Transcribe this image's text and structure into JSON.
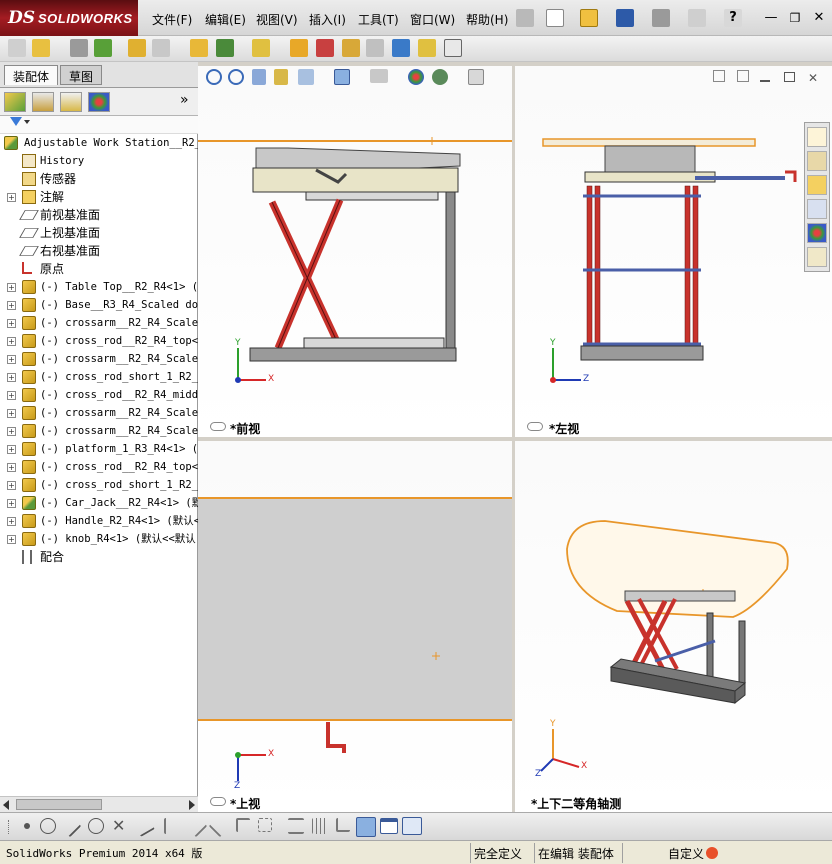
{
  "app": {
    "brand_ds": "DS",
    "brand_name": "SOLIDWORKS"
  },
  "menu": [
    "文件(F)",
    "编辑(E)",
    "视图(V)",
    "插入(I)",
    "工具(T)",
    "窗口(W)",
    "帮助(H)"
  ],
  "left_panel": {
    "tabs": [
      "装配体",
      "草图"
    ],
    "collapse_glyph": "»",
    "tree": [
      {
        "label": "Adjustable Work Station__R2_R4",
        "kind": "asm",
        "expand": ""
      },
      {
        "label": "History",
        "kind": "history",
        "expand": ""
      },
      {
        "label": "传感器",
        "kind": "sensor",
        "expand": ""
      },
      {
        "label": "注解",
        "kind": "annot",
        "expand": "+"
      },
      {
        "label": "前视基准面",
        "kind": "plane",
        "expand": ""
      },
      {
        "label": "上视基准面",
        "kind": "plane",
        "expand": ""
      },
      {
        "label": "右视基准面",
        "kind": "plane",
        "expand": ""
      },
      {
        "label": "原点",
        "kind": "origin",
        "expand": ""
      },
      {
        "label": "(-) Table Top__R2_R4<1> (默",
        "kind": "part",
        "expand": "+"
      },
      {
        "label": "(-) Base__R3_R4_Scaled dow",
        "kind": "part",
        "expand": "+"
      },
      {
        "label": "(-) crossarm__R2_R4_Scaled",
        "kind": "part",
        "expand": "+"
      },
      {
        "label": "(-) cross_rod__R2_R4_top<",
        "kind": "part",
        "expand": "+"
      },
      {
        "label": "(-) crossarm__R2_R4_Scaled",
        "kind": "part",
        "expand": "+"
      },
      {
        "label": "(-) cross_rod_short_1_R2_R",
        "kind": "part",
        "expand": "+"
      },
      {
        "label": "(-) cross_rod__R2_R4_middl",
        "kind": "part",
        "expand": "+"
      },
      {
        "label": "(-) crossarm__R2_R4_Scaled",
        "kind": "part",
        "expand": "+"
      },
      {
        "label": "(-) crossarm__R2_R4_Scaled",
        "kind": "part",
        "expand": "+"
      },
      {
        "label": "(-) platform_1_R3_R4<1> (默",
        "kind": "part",
        "expand": "+"
      },
      {
        "label": "(-) cross_rod__R2_R4_top<",
        "kind": "part",
        "expand": "+"
      },
      {
        "label": "(-) cross_rod_short_1_R2_R",
        "kind": "part",
        "expand": "+"
      },
      {
        "label": "(-) Car_Jack__R2_R4<1> (默",
        "kind": "asm",
        "expand": "+"
      },
      {
        "label": "(-) Handle_R2_R4<1> (默认<",
        "kind": "part",
        "expand": "+"
      },
      {
        "label": "(-) knob_R4<1> (默认<<默认",
        "kind": "part",
        "expand": "+"
      },
      {
        "label": "配合",
        "kind": "mate",
        "expand": ""
      }
    ]
  },
  "viewports": {
    "front": {
      "label": "*前视"
    },
    "left": {
      "label": "*左视"
    },
    "top": {
      "label": "*上视"
    },
    "iso": {
      "label": "*上下二等角轴测"
    }
  },
  "axes": {
    "x": "X",
    "y": "Y",
    "z": "Z"
  },
  "status": {
    "version": "SolidWorks Premium 2014 x64 版",
    "state1": "完全定义",
    "state2": "在编辑 装配体",
    "custom": "自定义"
  },
  "colors": {
    "accent_red": "#c8322c",
    "table_edge": "#e8962a",
    "frame_gray": "#5a5a5a",
    "rod_blue": "#4a5fa8"
  }
}
